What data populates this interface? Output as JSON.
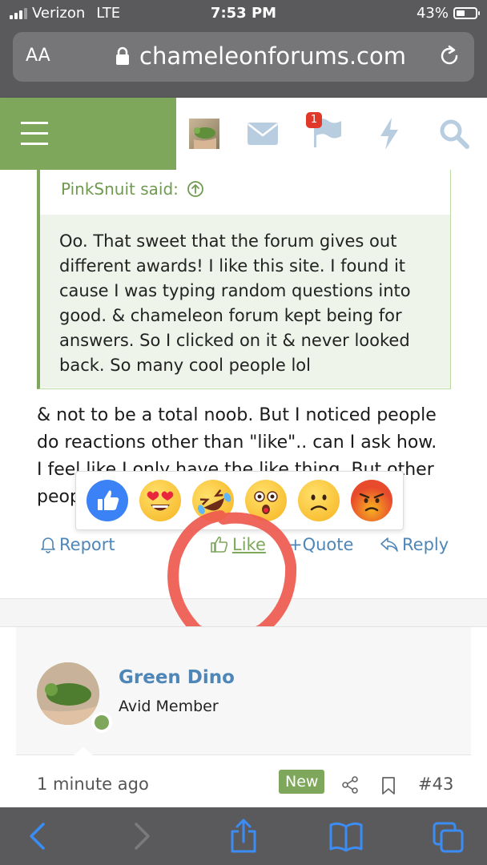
{
  "status_bar": {
    "carrier": "Verizon",
    "network": "LTE",
    "time": "7:53 PM",
    "battery": "43%"
  },
  "safari": {
    "text_size_label": "AA",
    "url": "chameleonforums.com"
  },
  "nav": {
    "alerts_count": "1",
    "icons": [
      "menu-icon",
      "user-avatar",
      "envelope-icon",
      "flag-icon",
      "bolt-icon",
      "search-icon"
    ]
  },
  "quote": {
    "author": "PinkSnuit said:",
    "text": "Oo. That sweet that the forum gives out different awards! I like this site. I found it cause I was typing random questions into good. & chameleon forum kept being for answers. So I clicked on it & never looked back. So many cool people lol"
  },
  "message": {
    "line1": "& not to be a total noob. But I noticed people",
    "line2": "do reactions other than \"like\".. can I ask how.",
    "line3": "I feel like I only have the like thing. But other",
    "line4": "peop"
  },
  "reactions": [
    "like",
    "love",
    "haha",
    "wow",
    "sad",
    "angry"
  ],
  "actions": {
    "report": "Report",
    "like": "Like",
    "quote": "+Quote",
    "reply": "Reply"
  },
  "next_post": {
    "username": "Green Dino",
    "user_title": "Avid Member",
    "time_ago": "1 minute ago",
    "badge": "New",
    "post_number": "#43"
  },
  "colors": {
    "forum_green": "#7ea75b",
    "link_blue": "#4f86b8",
    "safari_gray": "#5a5a5c",
    "annotation_red": "#ee5a4e"
  }
}
